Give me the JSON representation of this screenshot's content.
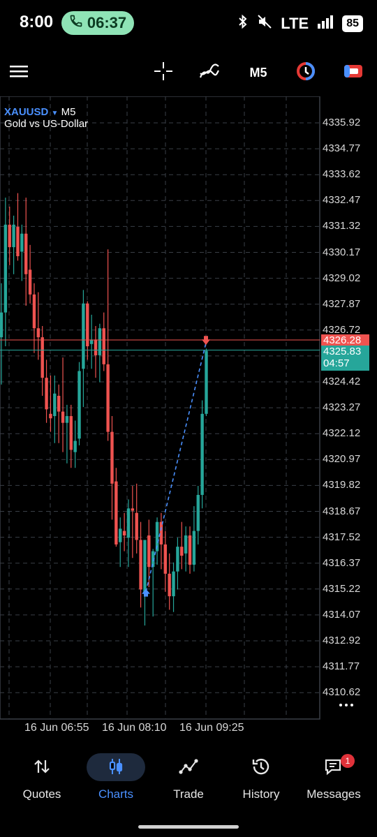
{
  "status_bar": {
    "time": "8:00",
    "call_timer": "06:37",
    "network": "LTE",
    "battery": "85"
  },
  "toolbar": {
    "timeframe": "M5"
  },
  "chart_header": {
    "symbol": "XAUUSD",
    "timeframe": "M5",
    "description": "Gold vs US-Dollar"
  },
  "chart_data": {
    "type": "candlestick",
    "symbol": "XAUUSD",
    "timeframe": "M5",
    "y_ticks": [
      "4335.92",
      "4334.77",
      "4333.62",
      "4332.47",
      "4331.32",
      "4330.17",
      "4329.02",
      "4327.87",
      "4326.72",
      "4324.42",
      "4323.27",
      "4322.12",
      "4320.97",
      "4319.82",
      "4318.67",
      "4317.52",
      "4316.37",
      "4315.22",
      "4314.07",
      "4312.92",
      "4311.77",
      "4310.62"
    ],
    "x_ticks": [
      "16 Jun 06:55",
      "16 Jun 08:10",
      "16 Jun 09:25"
    ],
    "ask_price": "4326.28",
    "bid_price": "4325.83",
    "bar_countdown": "04:57",
    "ylim": [
      4309.8,
      4337.0
    ],
    "candles": [
      {
        "o": 4326.4,
        "h": 4328.8,
        "l": 4324.3,
        "c": 4327.5
      },
      {
        "o": 4327.5,
        "h": 4332.6,
        "l": 4326.0,
        "c": 4331.4
      },
      {
        "o": 4331.4,
        "h": 4332.2,
        "l": 4329.6,
        "c": 4330.4
      },
      {
        "o": 4330.4,
        "h": 4331.8,
        "l": 4329.2,
        "c": 4331.4
      },
      {
        "o": 4331.3,
        "h": 4332.8,
        "l": 4329.8,
        "c": 4330.0
      },
      {
        "o": 4330.2,
        "h": 4331.4,
        "l": 4328.9,
        "c": 4331.0
      },
      {
        "o": 4331.0,
        "h": 4332.6,
        "l": 4327.8,
        "c": 4329.2
      },
      {
        "o": 4329.4,
        "h": 4330.5,
        "l": 4327.9,
        "c": 4328.3
      },
      {
        "o": 4328.3,
        "h": 4328.8,
        "l": 4325.7,
        "c": 4326.8
      },
      {
        "o": 4326.8,
        "h": 4328.4,
        "l": 4325.4,
        "c": 4326.4
      },
      {
        "o": 4326.4,
        "h": 4326.9,
        "l": 4323.8,
        "c": 4324.6
      },
      {
        "o": 4324.6,
        "h": 4325.4,
        "l": 4322.6,
        "c": 4323.2
      },
      {
        "o": 4323.0,
        "h": 4324.7,
        "l": 4322.2,
        "c": 4322.8
      },
      {
        "o": 4322.9,
        "h": 4324.7,
        "l": 4321.7,
        "c": 4323.9
      },
      {
        "o": 4323.8,
        "h": 4324.3,
        "l": 4321.7,
        "c": 4323.1
      },
      {
        "o": 4323.1,
        "h": 4325.5,
        "l": 4321.3,
        "c": 4322.6
      },
      {
        "o": 4322.6,
        "h": 4323.4,
        "l": 4320.8,
        "c": 4322.9
      },
      {
        "o": 4322.9,
        "h": 4323.4,
        "l": 4320.6,
        "c": 4321.4
      },
      {
        "o": 4321.3,
        "h": 4322.7,
        "l": 4320.6,
        "c": 4321.8
      },
      {
        "o": 4321.9,
        "h": 4325.3,
        "l": 4321.6,
        "c": 4324.9
      },
      {
        "o": 4325.0,
        "h": 4328.5,
        "l": 4323.3,
        "c": 4327.9
      },
      {
        "o": 4327.9,
        "h": 4328.0,
        "l": 4325.4,
        "c": 4326.0
      },
      {
        "o": 4326.1,
        "h": 4327.4,
        "l": 4325.0,
        "c": 4326.3
      },
      {
        "o": 4326.3,
        "h": 4326.9,
        "l": 4324.6,
        "c": 4325.6
      },
      {
        "o": 4325.6,
        "h": 4327.0,
        "l": 4324.4,
        "c": 4326.8
      },
      {
        "o": 4326.8,
        "h": 4327.5,
        "l": 4324.9,
        "c": 4325.2
      },
      {
        "o": 4325.2,
        "h": 4330.3,
        "l": 4321.8,
        "c": 4322.2
      },
      {
        "o": 4322.2,
        "h": 4322.9,
        "l": 4318.3,
        "c": 4319.9
      },
      {
        "o": 4320.0,
        "h": 4320.6,
        "l": 4317.1,
        "c": 4317.2
      },
      {
        "o": 4317.3,
        "h": 4318.4,
        "l": 4316.2,
        "c": 4317.9
      },
      {
        "o": 4317.8,
        "h": 4318.6,
        "l": 4316.9,
        "c": 4317.6
      },
      {
        "o": 4317.5,
        "h": 4319.2,
        "l": 4316.2,
        "c": 4318.8
      },
      {
        "o": 4318.8,
        "h": 4319.8,
        "l": 4316.6,
        "c": 4318.7
      },
      {
        "o": 4318.6,
        "h": 4319.9,
        "l": 4316.8,
        "c": 4317.4
      },
      {
        "o": 4317.4,
        "h": 4318.2,
        "l": 4314.4,
        "c": 4315.2
      },
      {
        "o": 4315.0,
        "h": 4317.2,
        "l": 4313.6,
        "c": 4317.4
      },
      {
        "o": 4317.6,
        "h": 4318.3,
        "l": 4315.3,
        "c": 4316.2
      },
      {
        "o": 4316.2,
        "h": 4317.0,
        "l": 4314.0,
        "c": 4316.9
      },
      {
        "o": 4316.9,
        "h": 4318.4,
        "l": 4316.3,
        "c": 4318.2
      },
      {
        "o": 4318.2,
        "h": 4318.6,
        "l": 4316.1,
        "c": 4317.2
      },
      {
        "o": 4317.2,
        "h": 4317.8,
        "l": 4315.1,
        "c": 4315.9
      },
      {
        "o": 4315.9,
        "h": 4316.8,
        "l": 4314.3,
        "c": 4314.9
      },
      {
        "o": 4314.9,
        "h": 4316.4,
        "l": 4314.2,
        "c": 4316.0
      },
      {
        "o": 4316.0,
        "h": 4317.5,
        "l": 4315.2,
        "c": 4317.1
      },
      {
        "o": 4317.1,
        "h": 4318.2,
        "l": 4316.1,
        "c": 4316.7
      },
      {
        "o": 4316.8,
        "h": 4318.0,
        "l": 4316.0,
        "c": 4317.6
      },
      {
        "o": 4317.6,
        "h": 4318.0,
        "l": 4315.9,
        "c": 4316.3
      },
      {
        "o": 4316.3,
        "h": 4318.9,
        "l": 4316.0,
        "c": 4317.8
      },
      {
        "o": 4317.8,
        "h": 4319.8,
        "l": 4317.2,
        "c": 4319.4
      },
      {
        "o": 4319.4,
        "h": 4323.6,
        "l": 4318.8,
        "c": 4323.0
      },
      {
        "o": 4323.0,
        "h": 4325.9,
        "l": 4322.9,
        "c": 4325.8
      }
    ],
    "trade": {
      "buy_price": 4315.1,
      "sell_price": 4326.15
    }
  },
  "bottom_nav": {
    "items": [
      {
        "label": "Quotes",
        "icon": "quotes-arrows-icon"
      },
      {
        "label": "Charts",
        "icon": "charts-candles-icon"
      },
      {
        "label": "Trade",
        "icon": "trade-line-icon"
      },
      {
        "label": "History",
        "icon": "history-clock-icon"
      },
      {
        "label": "Messages",
        "icon": "messages-chat-icon"
      }
    ],
    "active": "Charts",
    "messages_badge": "1"
  },
  "colors": {
    "bull": "#26a69a",
    "bear": "#ef5350",
    "accent": "#4a90ff",
    "grid": "#3a3f47",
    "ask_line": "#ef5350",
    "bid_line": "#26a69a"
  }
}
